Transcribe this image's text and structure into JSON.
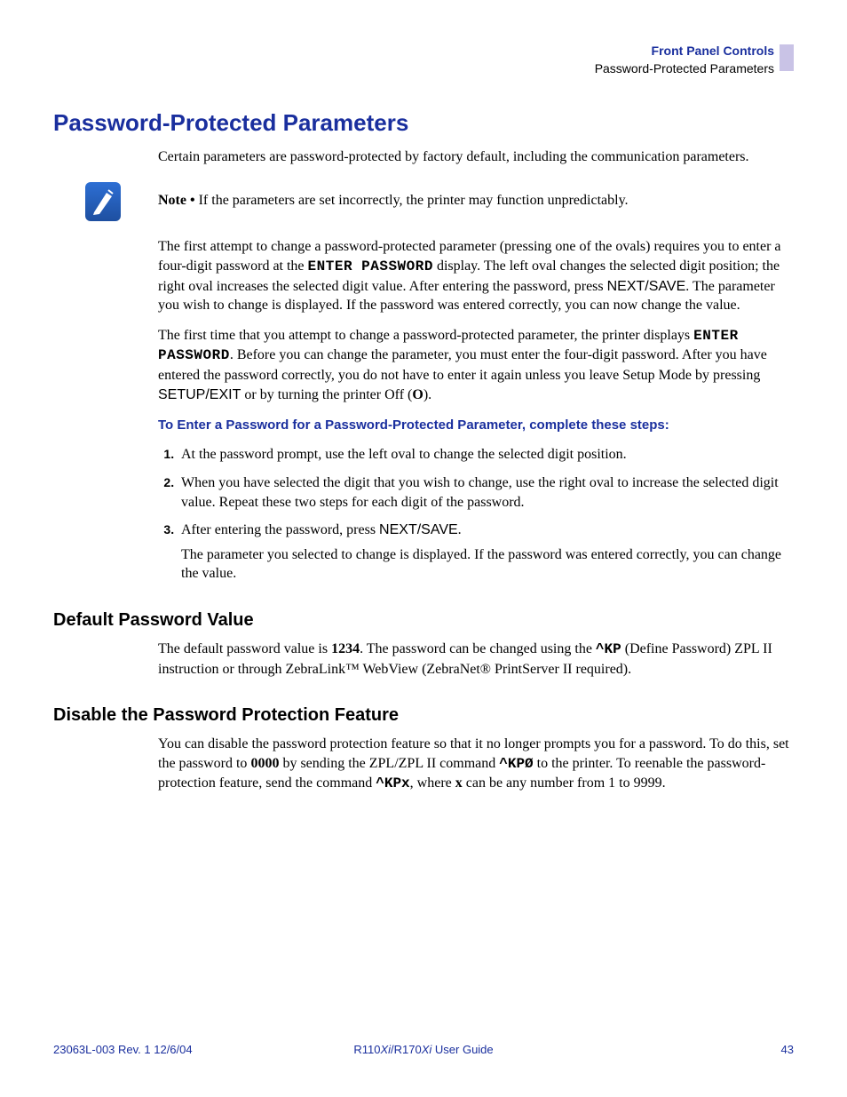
{
  "header": {
    "chapter": "Front Panel Controls",
    "section": "Password-Protected Parameters"
  },
  "h1": "Password-Protected Parameters",
  "intro": "Certain parameters are password-protected by factory default, including the communication parameters.",
  "note": {
    "label": "Note •",
    "text": "  If the parameters are set incorrectly, the printer may function unpredictably."
  },
  "para1": {
    "a": "The first attempt to change a password-protected parameter (pressing one of the ovals) requires you to enter a four-digit password at the ",
    "lcd": "ENTER PASSWORD",
    "b": " display. The left oval changes the selected digit position; the right oval increases the selected digit value. After entering the password, press ",
    "key": "NEXT/SAVE",
    "c": ". The parameter you wish to change is displayed. If the password was entered correctly, you can now change the value."
  },
  "para2": {
    "a": "The first time that you attempt to change a password-protected parameter, the printer displays ",
    "lcd": "ENTER PASSWORD",
    "b": ". Before you can change the parameter, you must enter the four-digit password. After you have entered the password correctly, you do not have to enter it again unless you leave Setup Mode by pressing ",
    "key": "SETUP/EXIT",
    "c": " or by turning the printer Off (",
    "off": "O",
    "d": ")."
  },
  "instr_heading": "To Enter a Password for a Password-Protected Parameter, complete these steps:",
  "steps": {
    "s1": "At the password prompt, use the left oval to change the selected digit position.",
    "s2": "When you have selected the digit that you wish to change, use the right oval to increase the selected digit value. Repeat these two steps for each digit of the password.",
    "s3a": "After entering the password, press ",
    "s3key": "NEXT/SAVE",
    "s3b": ".",
    "s3sub": "The parameter you selected to change is displayed. If the password was entered correctly, you can change the value."
  },
  "default_pw": {
    "heading": "Default Password Value",
    "a": "The default password value is ",
    "val": "1234",
    "b": ". The password can be changed using the ",
    "cmd": "^KP",
    "c": " (Define Password) ZPL II instruction or through ZebraLink™ WebView (ZebraNet® PrintServer II required)."
  },
  "disable": {
    "heading": "Disable the Password Protection Feature",
    "a": "You can disable the password protection feature so that it no longer prompts you for a password. To do this, set the password to ",
    "zero": "0000",
    "b": " by sending the ZPL/ZPL II command ",
    "cmd0": "^KPØ",
    "c": " to the printer. To reenable the password-protection feature, send the command ",
    "cmdx": "^KPx",
    "d": ", where ",
    "x": "x",
    "e": " can be any number from 1 to 9999."
  },
  "footer": {
    "left": "23063L-003 Rev. 1   12/6/04",
    "center_a": "R110",
    "center_i1": "Xi",
    "center_b": "/R170",
    "center_i2": "Xi",
    "center_c": " User Guide",
    "page": "43"
  }
}
